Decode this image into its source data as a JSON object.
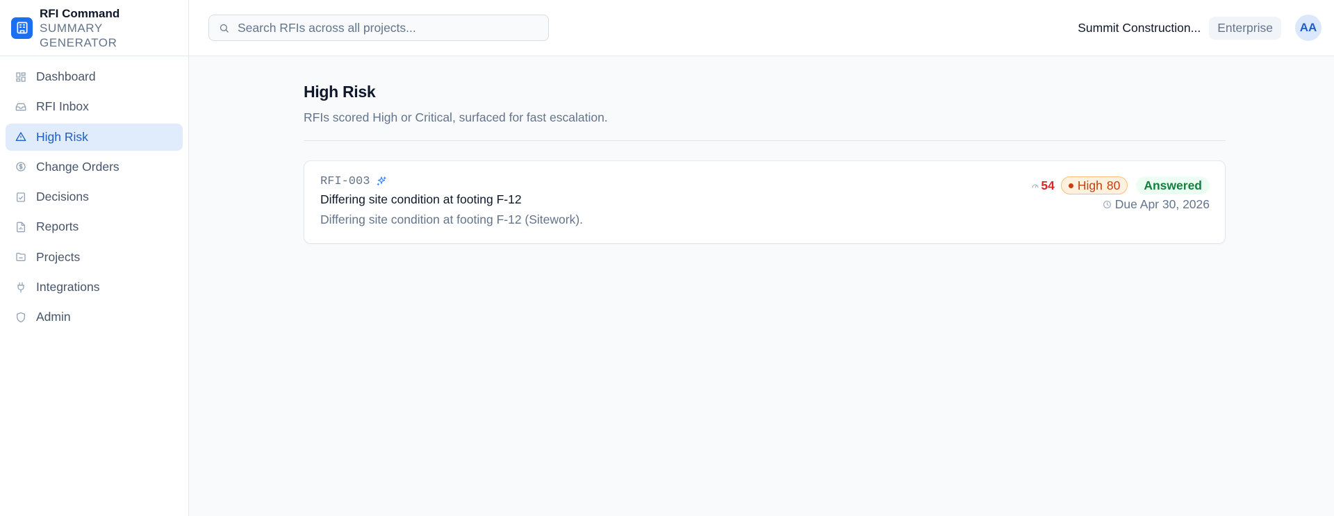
{
  "brand": {
    "name": "RFI Command",
    "subtitle_line1": "SUMMARY",
    "subtitle_line2": "GENERATOR",
    "logo_icon": "building-icon",
    "accent_color": "#1d6ff2"
  },
  "sidebar": {
    "items": [
      {
        "label": "Dashboard",
        "icon": "grid-icon",
        "active": false
      },
      {
        "label": "RFI Inbox",
        "icon": "inbox-icon",
        "active": false
      },
      {
        "label": "High Risk",
        "icon": "alert-triangle-icon",
        "active": true
      },
      {
        "label": "Change Orders",
        "icon": "dollar-circle-icon",
        "active": false
      },
      {
        "label": "Decisions",
        "icon": "clipboard-check-icon",
        "active": false
      },
      {
        "label": "Reports",
        "icon": "file-chart-icon",
        "active": false
      },
      {
        "label": "Projects",
        "icon": "folder-icon",
        "active": false
      },
      {
        "label": "Integrations",
        "icon": "plug-icon",
        "active": false
      },
      {
        "label": "Admin",
        "icon": "shield-icon",
        "active": false
      }
    ]
  },
  "header": {
    "search_placeholder": "Search RFIs across all projects...",
    "search_value": "",
    "org_name": "Summit Construction...",
    "plan": "Enterprise",
    "avatar_initials": "AA"
  },
  "main": {
    "title": "High Risk",
    "subtitle": "RFIs scored High or Critical, surfaced for fast escalation.",
    "rfis": [
      {
        "id": "RFI-003",
        "ai_icon": "sparkle-icon",
        "title": "Differing site condition at footing F-12",
        "description": "Differing site condition at footing F-12 (Sitework).",
        "score": "54",
        "risk_level": "High",
        "risk_score": "80",
        "status": "Answered",
        "due": "Due Apr 30, 2026"
      }
    ]
  },
  "colors": {
    "active_nav_bg": "#e0ecfb",
    "active_nav_text": "#1d5fc4",
    "risk_high": "#c2410c",
    "status_answered": "#15803d",
    "score_red": "#dc2626"
  }
}
